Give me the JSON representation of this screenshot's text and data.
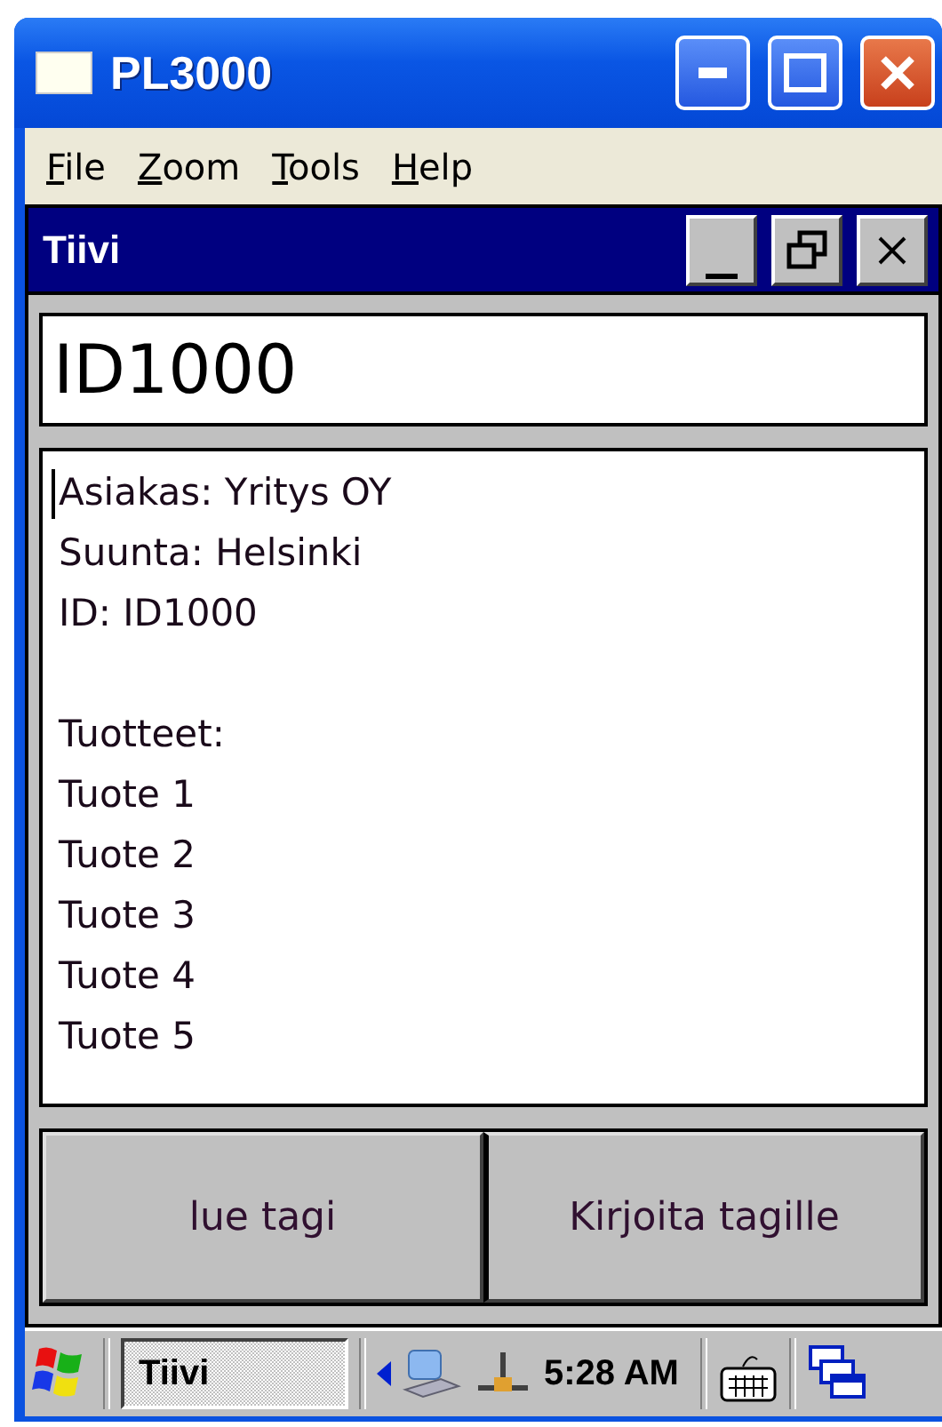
{
  "window": {
    "title": "PL3000"
  },
  "menu": [
    "File",
    "Zoom",
    "Tools",
    "Help"
  ],
  "app": {
    "title": "Tiivi"
  },
  "id_field": {
    "value": "ID1000"
  },
  "details": [
    [
      "Asiakas: Yritys OY",
      "Suunta: Helsinki",
      "ID: ID1000"
    ],
    [
      "Tuotteet:",
      "Tuote 1",
      "Tuote 2",
      "Tuote 3",
      "Tuote 4",
      "Tuote 5"
    ]
  ],
  "buttons": [
    "lue tagi",
    "Kirjoita tagille"
  ],
  "taskbar": {
    "task": "Tiivi",
    "clock": "5:28 AM"
  }
}
